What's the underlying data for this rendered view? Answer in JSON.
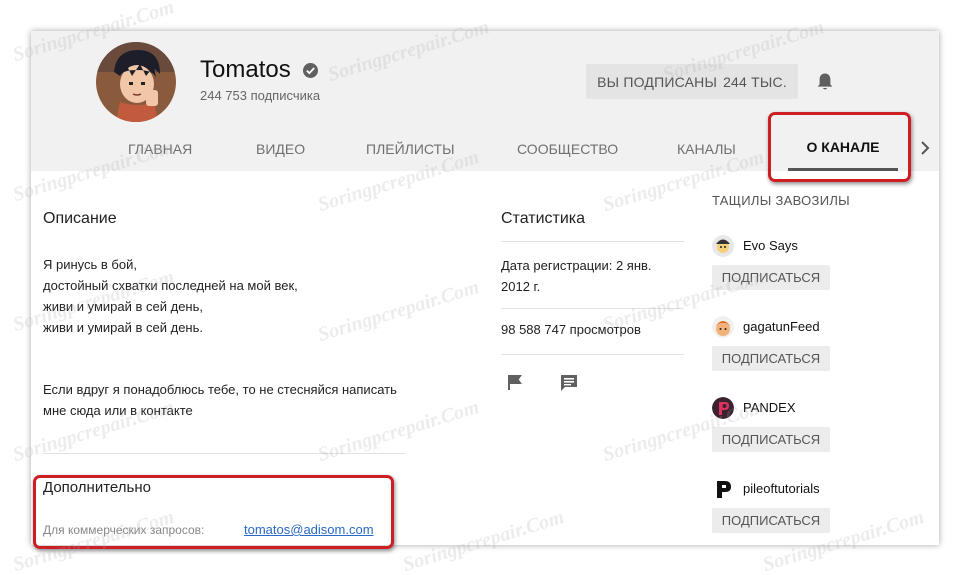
{
  "header": {
    "channel_name": "Tomatos",
    "subscriber_count": "244 753 подписчика",
    "subscribe_button": {
      "label": "Вы подписаны",
      "count": "244 тыс."
    }
  },
  "tabs": [
    {
      "label": "Главная",
      "active": false
    },
    {
      "label": "Видео",
      "active": false
    },
    {
      "label": "Плейлисты",
      "active": false
    },
    {
      "label": "Сообщество",
      "active": false
    },
    {
      "label": "Каналы",
      "active": false
    },
    {
      "label": "О канале",
      "active": true
    }
  ],
  "description": {
    "title": "Описание",
    "lines": [
      "Я ринусь в бой,",
      "достойный схватки последней на мой век,",
      "живи и умирай в сей день,",
      "живи и умирай в сей день."
    ],
    "extra": "Если вдруг я понадоблюсь тебе, то не стесняйся написать мне сюда или в контакте"
  },
  "additional": {
    "title": "Дополнительно",
    "business_label": "Для коммерческих запросов:",
    "business_email": "tomatos@adisom.com"
  },
  "stats": {
    "title": "Статистика",
    "registration": "Дата регистрации: 2 янв. 2012 г.",
    "views": "98 588 747 просмотров"
  },
  "recommended": {
    "title": "Тащилы завозилы",
    "channels": [
      {
        "name": "Evo Says",
        "button": "Подписаться"
      },
      {
        "name": "gagatunFeed",
        "button": "Подписаться"
      },
      {
        "name": "PANDEX",
        "button": "Подписаться"
      },
      {
        "name": "pileoftutorials",
        "button": "Подписаться"
      }
    ]
  },
  "watermark": "Soringpcrepair.Com",
  "colors": {
    "highlight": "#cc1e25",
    "link": "#2a69c7"
  }
}
